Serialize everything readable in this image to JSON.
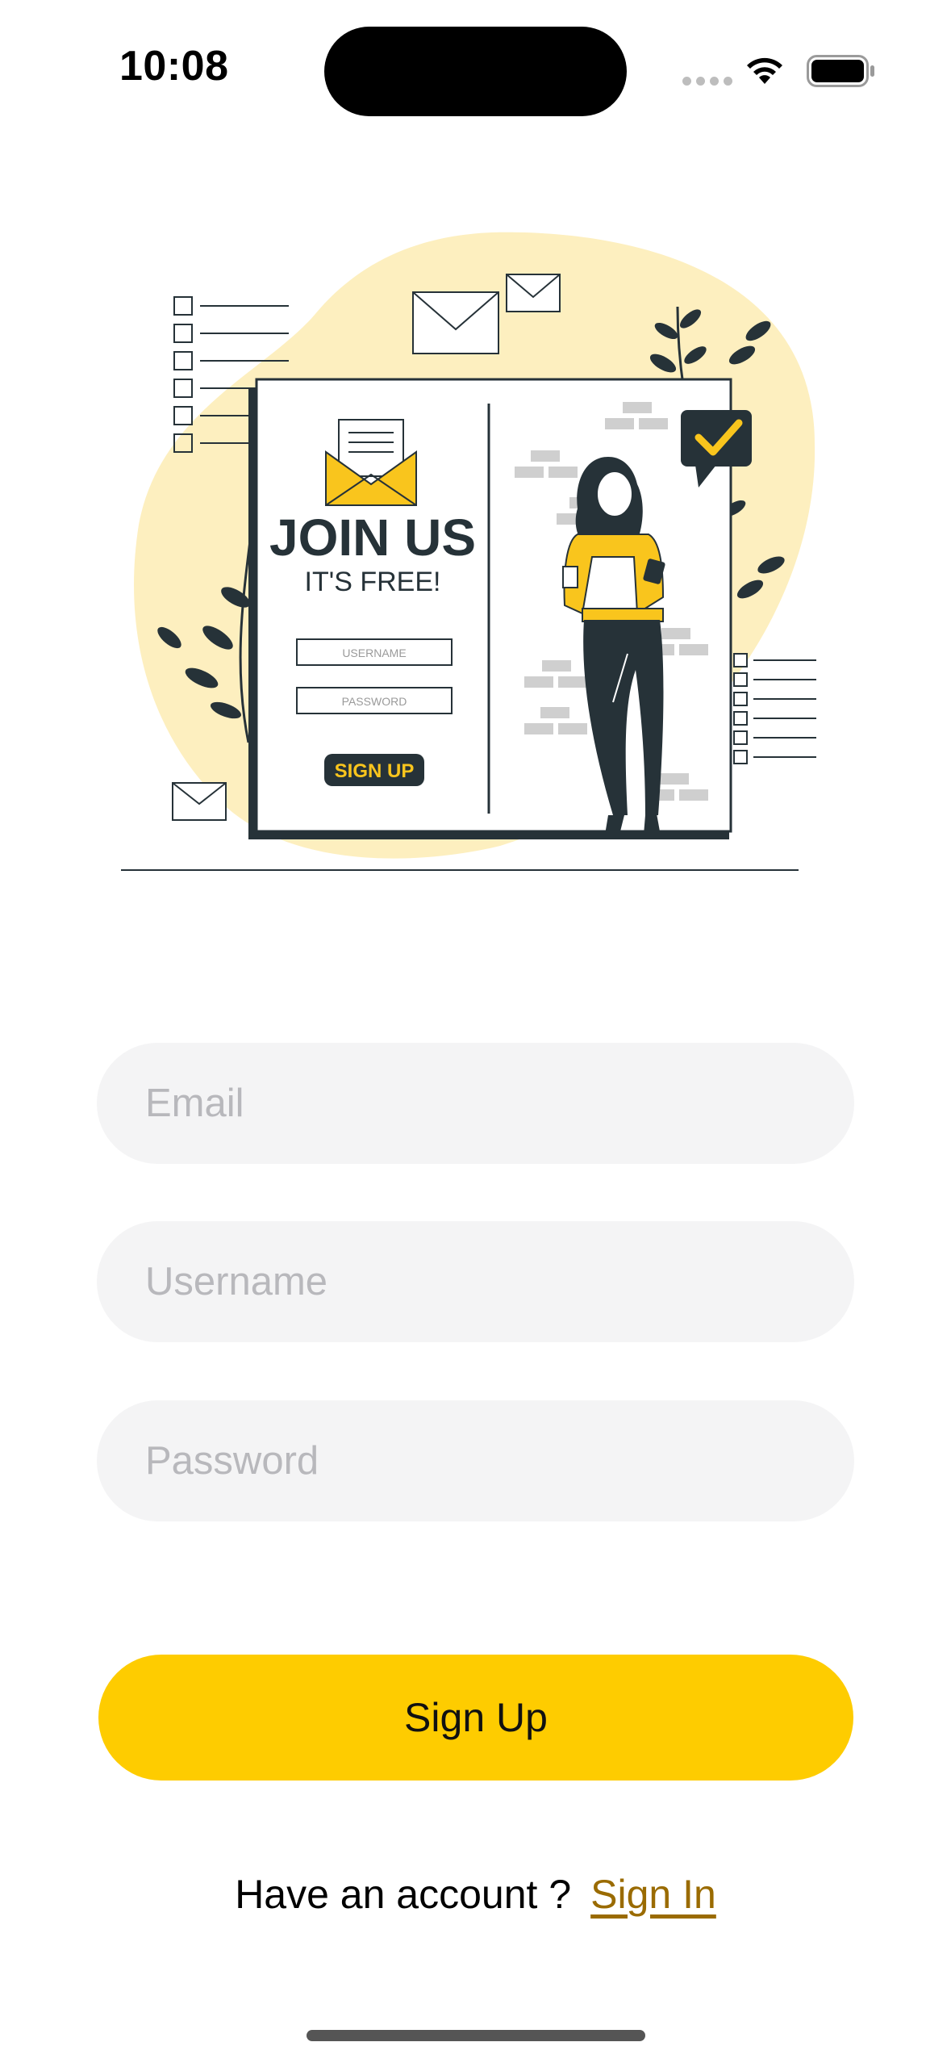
{
  "status_bar": {
    "time": "10:08"
  },
  "illustration": {
    "headline": "JOIN US",
    "subline": "IT'S FREE!",
    "username_label": "USERNAME",
    "password_label": "PASSWORD",
    "button_label": "SIGN UP",
    "accent_color": "#f9c51d",
    "blob_color": "#fdefbf",
    "dark_color": "#263238"
  },
  "form": {
    "email_placeholder": "Email",
    "username_placeholder": "Username",
    "password_placeholder": "Password",
    "submit_label": "Sign Up"
  },
  "footer": {
    "prompt": "Have an account ?",
    "link": "Sign In"
  }
}
